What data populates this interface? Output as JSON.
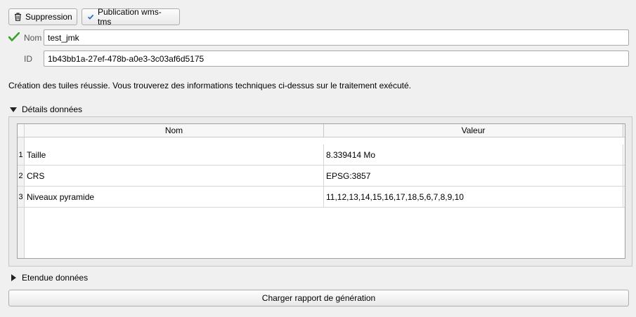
{
  "toolbar": {
    "delete_label": "Suppression",
    "publish_label": "Publication wms-tms"
  },
  "form": {
    "name_label": "Nom",
    "name_value": "test_jmk",
    "id_label": "ID",
    "id_value": "1b43bb1a-27ef-478b-a0e3-3c03af6d5175"
  },
  "status_message": "Création des tuiles réussie. Vous trouverez des informations techniques ci-dessus sur le traitement exécuté.",
  "details": {
    "title": "Détails données",
    "columns": [
      "Nom",
      "Valeur"
    ],
    "rows": [
      {
        "num": "1",
        "name": "Taille",
        "value": "8.339414 Mo"
      },
      {
        "num": "2",
        "name": "CRS",
        "value": "EPSG:3857"
      },
      {
        "num": "3",
        "name": "Niveaux pyramide",
        "value": "11,12,13,14,15,16,17,18,5,6,7,8,9,10"
      }
    ]
  },
  "extent": {
    "title": "Etendue données"
  },
  "report_button_label": "Charger rapport de génération",
  "colors": {
    "check_green": "#3aa12b",
    "publish_check_blue": "#2f6fc9"
  }
}
